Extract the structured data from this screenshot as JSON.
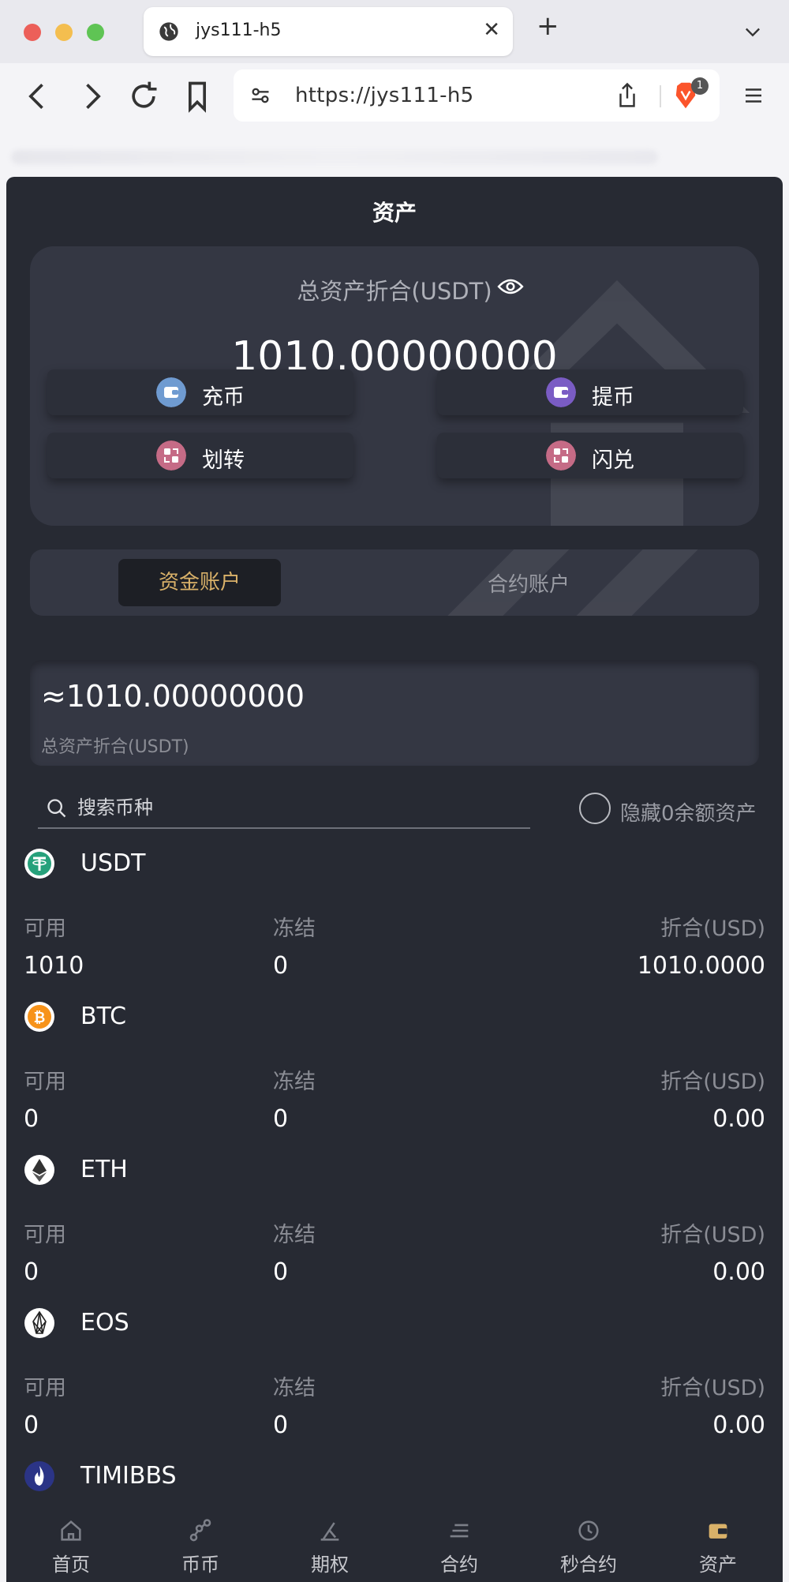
{
  "browser": {
    "tab_title": "jys111-h5",
    "url": "https://jys111-h5",
    "extension_badge": "1",
    "traffic_lights": [
      "#ec5f59",
      "#f4be4f",
      "#5fc454"
    ]
  },
  "app": {
    "page_title": "资产",
    "total_card": {
      "label": "总资产折合(USDT)",
      "amount": "1010.00000000"
    },
    "actions": [
      {
        "label": "充币",
        "icon": "wallet-deposit-icon",
        "color": "#6f9bd1"
      },
      {
        "label": "提币",
        "icon": "wallet-withdraw-icon",
        "color": "#7a5cc4"
      },
      {
        "label": "划转",
        "icon": "transfer-icon",
        "color": "#c56b86"
      },
      {
        "label": "闪兑",
        "icon": "flash-exchange-icon",
        "color": "#c56b86"
      }
    ],
    "account_tabs": {
      "active": "资金账户",
      "inactive": "合约账户",
      "active_color": "#d9b169"
    },
    "summary": {
      "amount": "≈1010.00000000",
      "label": "总资产折合(USDT)"
    },
    "search": {
      "placeholder": "搜索币种"
    },
    "hide_zero_label": "隐藏0余额资产",
    "column_labels": {
      "available": "可用",
      "frozen": "冻结",
      "converted": "折合(USD)"
    },
    "coins": [
      {
        "name": "USDT",
        "icon": "tether-icon",
        "available": "1010",
        "frozen": "0",
        "converted": "1010.0000"
      },
      {
        "name": "BTC",
        "icon": "bitcoin-icon",
        "available": "0",
        "frozen": "0",
        "converted": "0.00"
      },
      {
        "name": "ETH",
        "icon": "ethereum-icon",
        "available": "0",
        "frozen": "0",
        "converted": "0.00"
      },
      {
        "name": "EOS",
        "icon": "eos-icon",
        "available": "0",
        "frozen": "0",
        "converted": "0.00"
      },
      {
        "name": "TIMIBBS",
        "icon": "flame-icon"
      }
    ],
    "bottom_nav": [
      {
        "label": "首页",
        "icon": "home-icon"
      },
      {
        "label": "币币",
        "icon": "chart-nodes-icon"
      },
      {
        "label": "期权",
        "icon": "options-icon"
      },
      {
        "label": "合约",
        "icon": "contract-icon"
      },
      {
        "label": "秒合约",
        "icon": "seconds-contract-icon"
      },
      {
        "label": "资产",
        "icon": "assets-icon"
      }
    ]
  }
}
